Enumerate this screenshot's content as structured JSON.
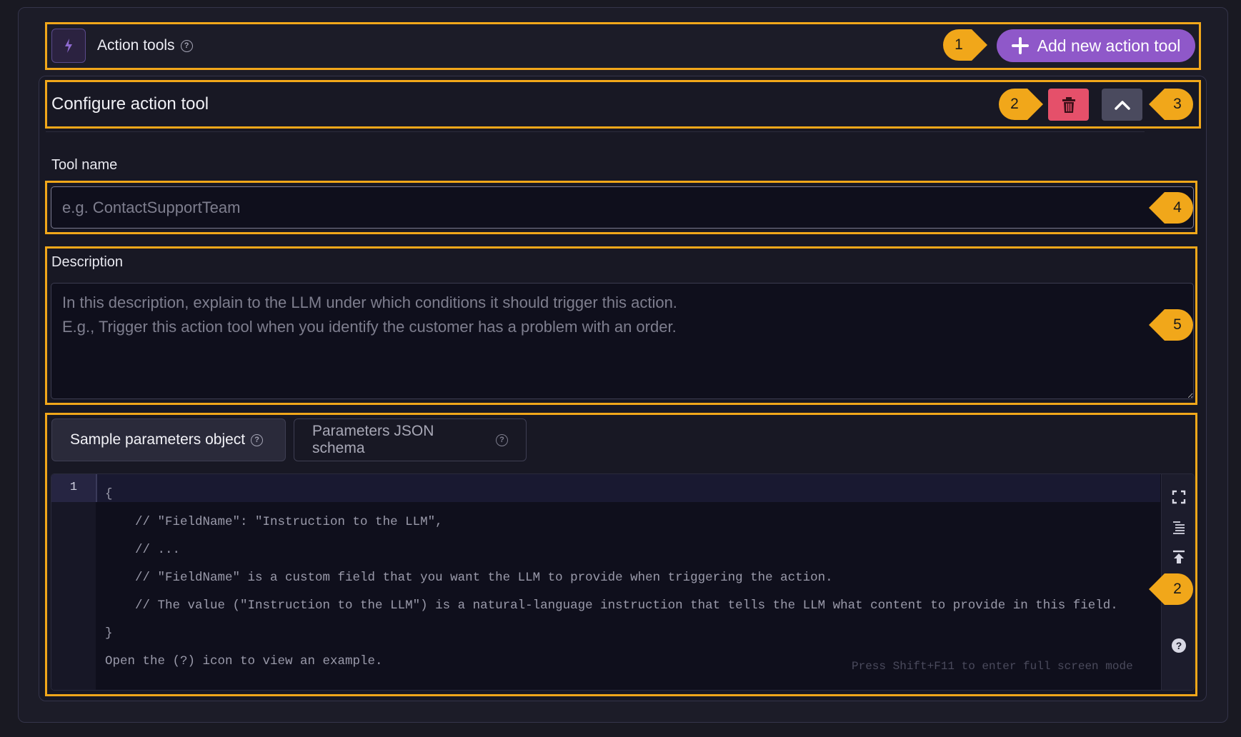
{
  "header": {
    "title": "Action tools",
    "help_icon": "question-circle-icon",
    "bolt_icon": "lightning-bolt-icon",
    "add_button_label": "Add new action tool",
    "add_icon": "plus-icon",
    "accent": "#8f58c9"
  },
  "config": {
    "title": "Configure action tool",
    "delete_icon": "trash-icon",
    "collapse_icon": "chevron-up-icon",
    "delete_color": "#e5506a"
  },
  "tool_name": {
    "label": "Tool name",
    "placeholder": "e.g. ContactSupportTeam",
    "value": ""
  },
  "description": {
    "label": "Description",
    "placeholder": "In this description, explain to the LLM under which conditions it should trigger this action.\nE.g., Trigger this action tool when you identify the customer has a problem with an order.",
    "value": ""
  },
  "params": {
    "tabs": [
      {
        "label": "Sample parameters object",
        "active": true
      },
      {
        "label": "Parameters JSON schema",
        "active": false
      }
    ],
    "editor": {
      "line_number": "1",
      "code": "{\n    // \"FieldName\": \"Instruction to the LLM\",\n    // ...\n    // \"FieldName\" is a custom field that you want the LLM to provide when triggering the action.\n    // The value (\"Instruction to the LLM\") is a natural-language instruction that tells the LLM what content to provide in this field.\n}\nOpen the (?) icon to view an example.",
      "fullscreen_hint": "Press Shift+F11 to enter full screen mode",
      "side_icons": [
        "fullscreen-icon",
        "format-icon",
        "collapse-top-icon",
        "help-icon"
      ]
    }
  },
  "annotations": {
    "color": "#f1a71a",
    "badges": [
      "1",
      "2",
      "3",
      "4",
      "5",
      "2"
    ]
  }
}
